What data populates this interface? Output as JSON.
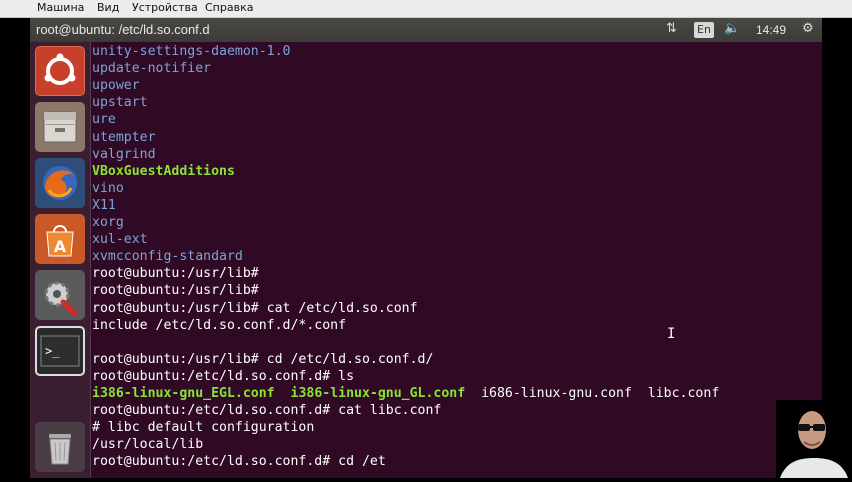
{
  "vm_menu": {
    "items": [
      "Машина",
      "Вид",
      "Устройства",
      "Справка"
    ]
  },
  "topbar": {
    "title": "root@ubuntu: /etc/ld.so.conf.d",
    "lang": "En",
    "time": "14:49"
  },
  "launcher": {
    "icons": [
      "ubuntu-dash-icon",
      "files-icon",
      "firefox-icon",
      "software-center-icon",
      "settings-icon",
      "terminal-icon",
      "trash-icon"
    ]
  },
  "colors": {
    "dir": "#7ea3d6",
    "exec": "#8ae234",
    "text": "#ffffff",
    "background": "#300a24"
  },
  "terminal": {
    "lines": [
      [
        {
          "t": "unity-settings-daemon-1.0",
          "c": "dir"
        }
      ],
      [
        {
          "t": "update-notifier",
          "c": "dir"
        }
      ],
      [
        {
          "t": "upower",
          "c": "dir"
        }
      ],
      [
        {
          "t": "upstart",
          "c": "dir"
        }
      ],
      [
        {
          "t": "ure",
          "c": "dir"
        }
      ],
      [
        {
          "t": "utempter",
          "c": "dir"
        }
      ],
      [
        {
          "t": "valgrind",
          "c": "dir"
        }
      ],
      [
        {
          "t": "VBoxGuestAdditions",
          "c": "exec"
        }
      ],
      [
        {
          "t": "vino",
          "c": "dir"
        }
      ],
      [
        {
          "t": "X11",
          "c": "dir"
        }
      ],
      [
        {
          "t": "xorg",
          "c": "dir"
        }
      ],
      [
        {
          "t": "xul-ext",
          "c": "dir"
        }
      ],
      [
        {
          "t": "xvmcconfig-standard",
          "c": "dir"
        }
      ],
      [
        {
          "t": "root@ubuntu:/usr/lib#",
          "c": "text"
        }
      ],
      [
        {
          "t": "root@ubuntu:/usr/lib#",
          "c": "text"
        }
      ],
      [
        {
          "t": "root@ubuntu:/usr/lib# cat /etc/ld.so.conf",
          "c": "text"
        }
      ],
      [
        {
          "t": "include /etc/ld.so.conf.d/*.conf",
          "c": "text"
        }
      ],
      [
        {
          "t": "",
          "c": "text"
        }
      ],
      [
        {
          "t": "root@ubuntu:/usr/lib# cd /etc/ld.so.conf.d/",
          "c": "text"
        }
      ],
      [
        {
          "t": "root@ubuntu:/etc/ld.so.conf.d# ls",
          "c": "text"
        }
      ],
      [
        {
          "t": "i386-linux-gnu_EGL.conf",
          "c": "exec"
        },
        {
          "t": "  ",
          "c": "text"
        },
        {
          "t": "i386-linux-gnu_GL.conf",
          "c": "exec"
        },
        {
          "t": "  i686-linux-gnu.conf  libc.conf",
          "c": "text"
        }
      ],
      [
        {
          "t": "root@ubuntu:/etc/ld.so.conf.d# cat libc.conf",
          "c": "text"
        }
      ],
      [
        {
          "t": "# libc default configuration",
          "c": "text"
        }
      ],
      [
        {
          "t": "/usr/local/lib",
          "c": "text"
        }
      ],
      [
        {
          "t": "root@ubuntu:/etc/ld.so.conf.d# cd /et",
          "c": "text"
        }
      ]
    ]
  }
}
